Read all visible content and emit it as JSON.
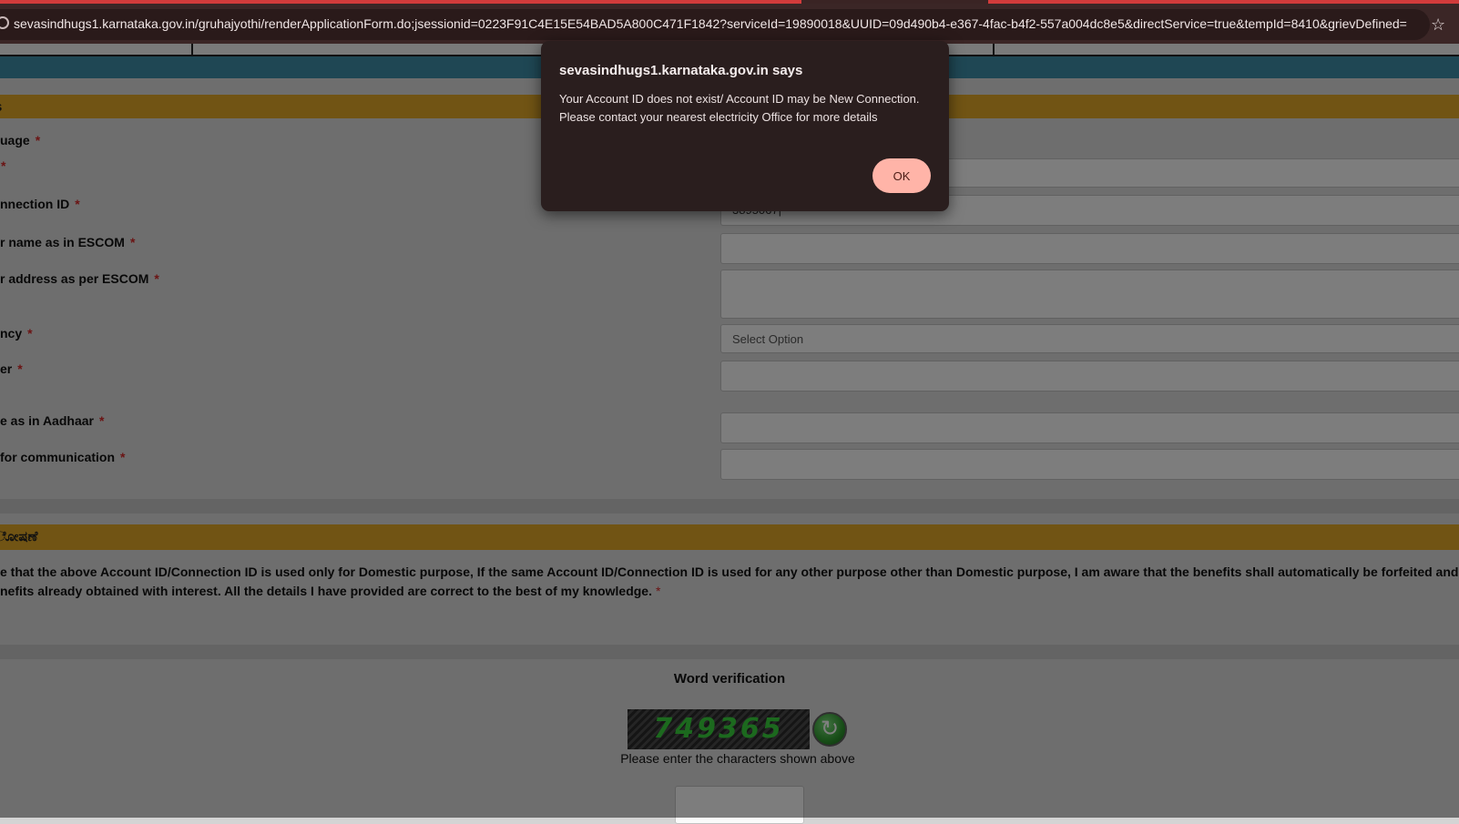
{
  "browser": {
    "url": "sevasindhugs1.karnataka.gov.in/gruhajyothi/renderApplicationForm.do;jsessionid=0223F91C4E15E54BAD5A800C471F1842?serviceId=19890018&UUID=09d490b4-e367-4fac-b4f2-557a004dc8e5&directService=true&tempId=8410&grievDefined=0...",
    "bookmark_icon": "star-icon"
  },
  "form": {
    "section_title": "s",
    "labels": {
      "language": "uage",
      "row2": "",
      "connection_id": "nnection ID",
      "name_escom": "r name as in ESCOM",
      "address_escom": "r address as per ESCOM",
      "tenancy": "ncy",
      "number": "er",
      "aadhaar_name": "e as in Aadhaar",
      "communication": "for communication"
    },
    "required_mark": "*",
    "connection_id_value": "3895067",
    "tenancy_placeholder": "Select Option"
  },
  "declaration": {
    "section_title": "ೋಷಣೆ",
    "line1": "e that the above Account ID/Connection ID is used only for Domestic purpose, If the same Account ID/Connection ID is used for any other purpose other than Domestic purpose, I am aware that the benefits shall automatically be forfeited and",
    "line2": "nefits already obtained with interest. All the details I have provided are correct to the best of my knowledge."
  },
  "verification": {
    "title": "Word verification",
    "captcha_text": "749365",
    "note": "Please enter the characters shown above"
  },
  "dialog": {
    "title": "sevasindhugs1.karnataka.gov.in says",
    "message_line1": "Your Account ID does not exist/ Account ID may be New Connection.",
    "message_line2": "Please contact your nearest electricity Office for more details",
    "ok_label": "OK"
  }
}
